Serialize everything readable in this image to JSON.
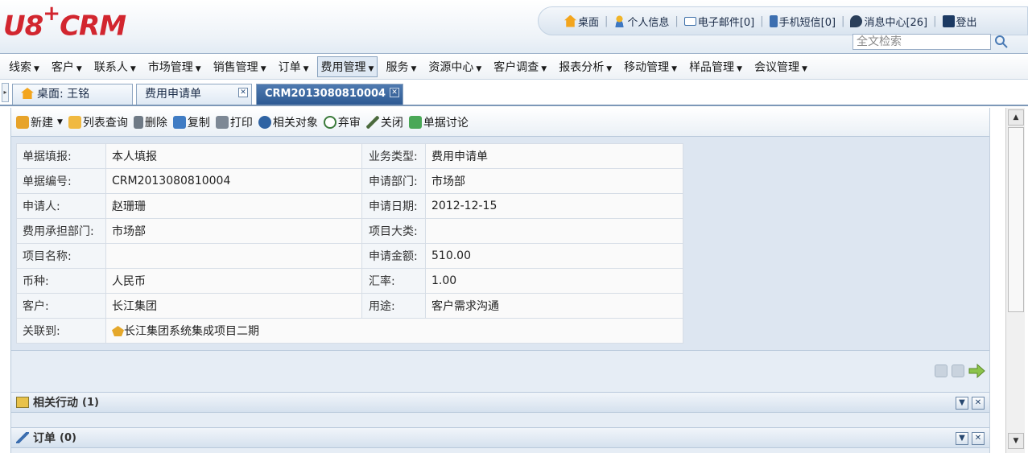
{
  "header": {
    "logo": "U8",
    "logo_plus": "+",
    "logo_suffix": "CRM",
    "links": [
      {
        "label": "桌面",
        "icon": "home-icon"
      },
      {
        "label": "个人信息",
        "icon": "user-icon"
      },
      {
        "label": "电子邮件[0]",
        "icon": "mail-icon"
      },
      {
        "label": "手机短信[0]",
        "icon": "mobile-icon"
      },
      {
        "label": "消息中心[26]",
        "icon": "message-icon"
      },
      {
        "label": "登出",
        "icon": "logout-icon"
      }
    ],
    "search_placeholder": "全文检索"
  },
  "menu": [
    {
      "label": "线索"
    },
    {
      "label": "客户"
    },
    {
      "label": "联系人"
    },
    {
      "label": "市场管理"
    },
    {
      "label": "销售管理"
    },
    {
      "label": "订单"
    },
    {
      "label": "费用管理"
    },
    {
      "label": "服务"
    },
    {
      "label": "资源中心"
    },
    {
      "label": "客户调查"
    },
    {
      "label": "报表分析"
    },
    {
      "label": "移动管理"
    },
    {
      "label": "样品管理"
    },
    {
      "label": "会议管理"
    }
  ],
  "tabs": [
    {
      "label": "桌面: 王铭"
    },
    {
      "label": "费用申请单"
    },
    {
      "label": "CRM2013080810004"
    }
  ],
  "toolbar": {
    "new": "新建",
    "list_query": "列表查询",
    "delete": "删除",
    "copy": "复制",
    "print": "打印",
    "related": "相关对象",
    "abandon": "弃审",
    "close": "关闭",
    "discuss": "单据讨论"
  },
  "form": {
    "rows": [
      {
        "l1": "单据填报:",
        "v1": "本人填报",
        "l2": "业务类型:",
        "v2": "费用申请单"
      },
      {
        "l1": "单据编号:",
        "v1": "CRM2013080810004",
        "l2": "申请部门:",
        "v2": "市场部"
      },
      {
        "l1": "申请人:",
        "v1": "赵珊珊",
        "l2": "申请日期:",
        "v2": "2012-12-15"
      },
      {
        "l1": "费用承担部门:",
        "v1": "市场部",
        "l2": "项目大类:",
        "v2": ""
      },
      {
        "l1": "项目名称:",
        "v1": "",
        "l2": "申请金额:",
        "v2": "510.00"
      },
      {
        "l1": "币种:",
        "v1": "人民币",
        "l2": "汇率:",
        "v2": "1.00"
      },
      {
        "l1": "客户:",
        "v1": "长江集团",
        "l2": "用途:",
        "v2": "客户需求沟通"
      }
    ],
    "linked_label": "关联到:",
    "linked_value": "长江集团系统集成项目二期"
  },
  "sections": [
    {
      "title": "相关行动",
      "count": "(1)"
    },
    {
      "title": "订单",
      "count": "(0)"
    }
  ],
  "colors": {
    "brand_red": "#d2262f",
    "active_tab": "#2d5a93",
    "panel_bg": "#dde6f1"
  }
}
